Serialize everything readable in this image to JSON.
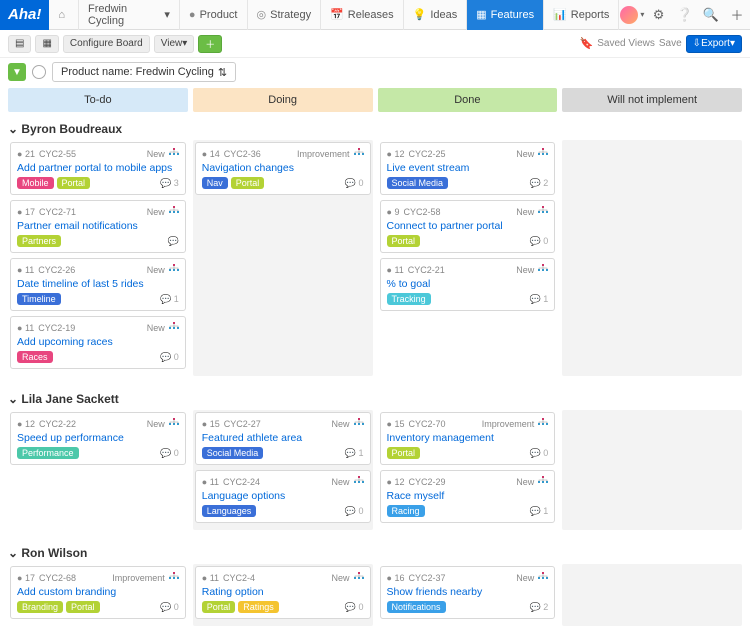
{
  "nav": {
    "logo": "Aha!",
    "workspace": "Fredwin Cycling",
    "items": [
      {
        "icon": "●",
        "label": "Product"
      },
      {
        "icon": "◎",
        "label": "Strategy"
      },
      {
        "icon": "📅",
        "label": "Releases"
      },
      {
        "icon": "💡",
        "label": "Ideas"
      },
      {
        "icon": "▦",
        "label": "Features",
        "active": true
      },
      {
        "icon": "📊",
        "label": "Reports"
      }
    ]
  },
  "toolbar": {
    "configure": "Configure Board",
    "view": "View",
    "saved": "Saved Views",
    "save": "Save",
    "export": "Export"
  },
  "filter": {
    "label": "Product name: Fredwin Cycling"
  },
  "columns": [
    "To-do",
    "Doing",
    "Done",
    "Will not implement"
  ],
  "swimlanes": [
    {
      "name": "Byron Boudreaux",
      "lanes": [
        [
          {
            "pts": "21",
            "id": "CYC2-55",
            "status": "New",
            "title": "Add partner portal to mobile apps",
            "comments": "3",
            "tags": [
              {
                "t": "Mobile",
                "c": "#e8467f"
              },
              {
                "t": "Portal",
                "c": "#b3d235"
              }
            ]
          },
          {
            "pts": "17",
            "id": "CYC2-71",
            "status": "New",
            "title": "Partner email notifications",
            "comments": "",
            "tags": [
              {
                "t": "Partners",
                "c": "#b3d235"
              }
            ]
          },
          {
            "pts": "11",
            "id": "CYC2-26",
            "status": "New",
            "title": "Date timeline of last 5 rides",
            "comments": "1",
            "tags": [
              {
                "t": "Timeline",
                "c": "#3a6fd8"
              }
            ]
          },
          {
            "pts": "11",
            "id": "CYC2-19",
            "status": "New",
            "title": "Add upcoming races",
            "comments": "0",
            "tags": [
              {
                "t": "Races",
                "c": "#e8467f"
              }
            ]
          }
        ],
        [
          {
            "pts": "14",
            "id": "CYC2-36",
            "status": "Improvement",
            "title": "Navigation changes",
            "comments": "0",
            "tags": [
              {
                "t": "Nav",
                "c": "#3a6fd8"
              },
              {
                "t": "Portal",
                "c": "#b3d235"
              }
            ]
          }
        ],
        [
          {
            "pts": "12",
            "id": "CYC2-25",
            "status": "New",
            "title": "Live event stream",
            "comments": "2",
            "tags": [
              {
                "t": "Social Media",
                "c": "#3a6fd8"
              }
            ]
          },
          {
            "pts": "9",
            "id": "CYC2-58",
            "status": "New",
            "title": "Connect to partner portal",
            "comments": "0",
            "tags": [
              {
                "t": "Portal",
                "c": "#b3d235"
              }
            ]
          },
          {
            "pts": "11",
            "id": "CYC2-21",
            "status": "New",
            "title": "% to goal",
            "comments": "1",
            "tags": [
              {
                "t": "Tracking",
                "c": "#4cc8d9"
              }
            ]
          }
        ],
        []
      ]
    },
    {
      "name": "Lila Jane Sackett",
      "lanes": [
        [
          {
            "pts": "12",
            "id": "CYC2-22",
            "status": "New",
            "title": "Speed up performance",
            "comments": "0",
            "tags": [
              {
                "t": "Performance",
                "c": "#4cc8a9"
              }
            ]
          }
        ],
        [
          {
            "pts": "15",
            "id": "CYC2-27",
            "status": "New",
            "title": "Featured athlete area",
            "comments": "1",
            "tags": [
              {
                "t": "Social Media",
                "c": "#3a6fd8"
              }
            ]
          },
          {
            "pts": "11",
            "id": "CYC2-24",
            "status": "New",
            "title": "Language options",
            "comments": "0",
            "tags": [
              {
                "t": "Languages",
                "c": "#3a6fd8"
              }
            ]
          }
        ],
        [
          {
            "pts": "15",
            "id": "CYC2-70",
            "status": "Improvement",
            "title": "Inventory management",
            "comments": "0",
            "tags": [
              {
                "t": "Portal",
                "c": "#b3d235"
              }
            ]
          },
          {
            "pts": "12",
            "id": "CYC2-29",
            "status": "New",
            "title": "Race myself",
            "comments": "1",
            "tags": [
              {
                "t": "Racing",
                "c": "#3aa0e8"
              }
            ]
          }
        ],
        []
      ]
    },
    {
      "name": "Ron Wilson",
      "lanes": [
        [
          {
            "pts": "17",
            "id": "CYC2-68",
            "status": "Improvement",
            "title": "Add custom branding",
            "comments": "0",
            "tags": [
              {
                "t": "Branding",
                "c": "#b3d235"
              },
              {
                "t": "Portal",
                "c": "#b3d235"
              }
            ]
          }
        ],
        [
          {
            "pts": "11",
            "id": "CYC2-4",
            "status": "New",
            "title": "Rating option",
            "comments": "0",
            "tags": [
              {
                "t": "Portal",
                "c": "#b3d235"
              },
              {
                "t": "Ratings",
                "c": "#f4c430"
              }
            ]
          }
        ],
        [
          {
            "pts": "16",
            "id": "CYC2-37",
            "status": "New",
            "title": "Show friends nearby",
            "comments": "2",
            "tags": [
              {
                "t": "Notifications",
                "c": "#3aa0e8"
              }
            ]
          }
        ],
        []
      ]
    }
  ]
}
